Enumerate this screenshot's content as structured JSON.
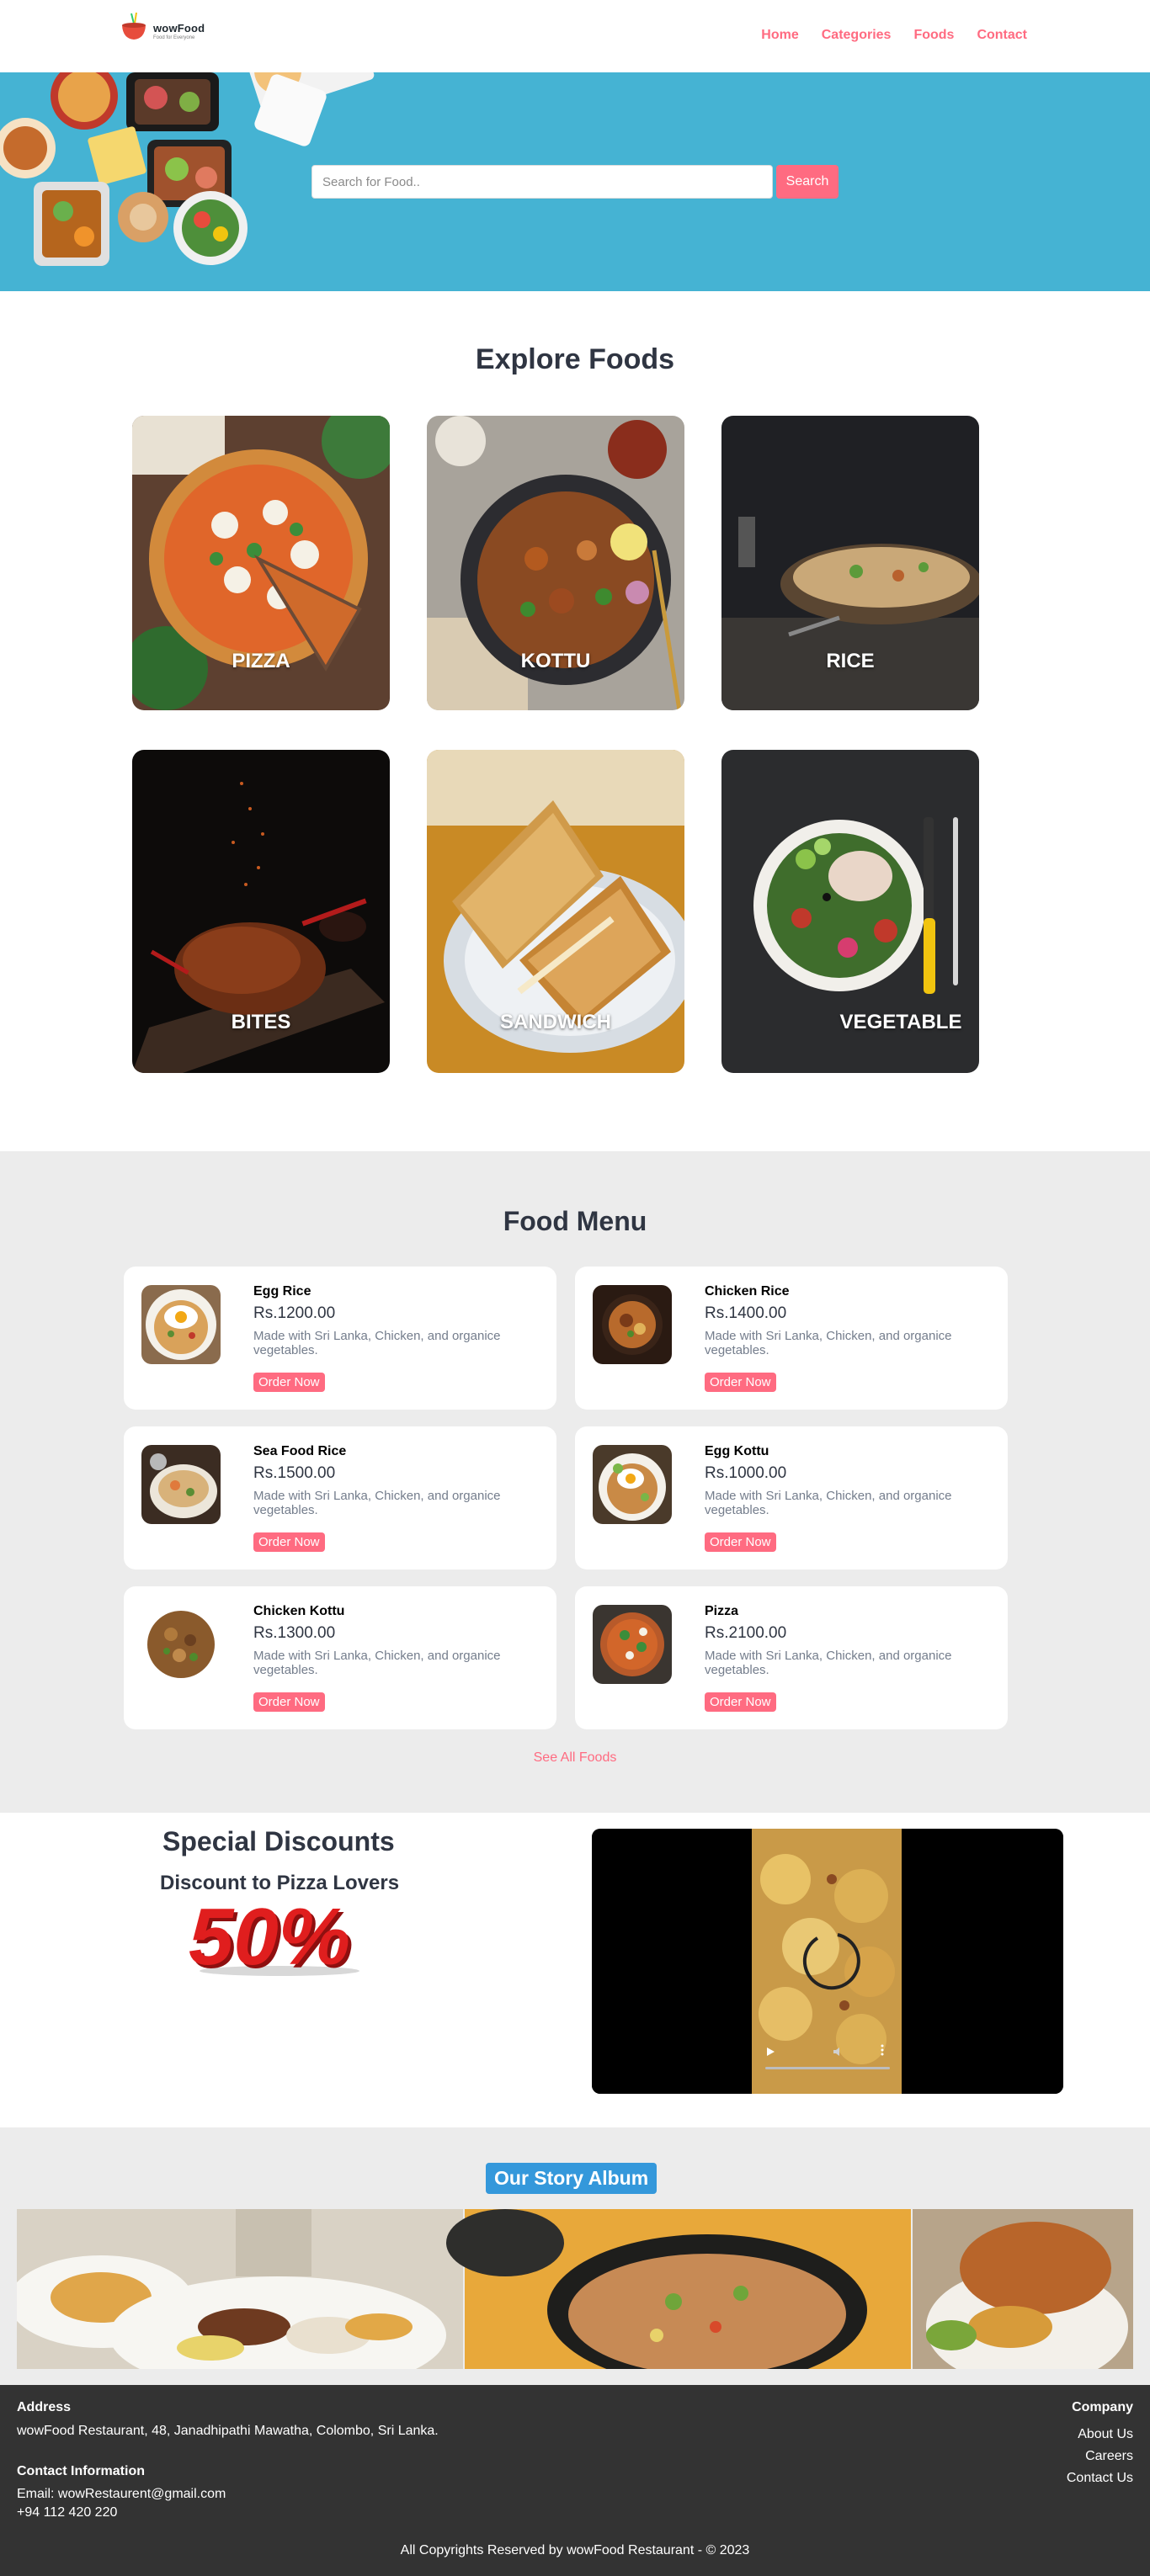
{
  "nav": {
    "logo_name": "wowFood",
    "logo_tagline": "Food for Everyone",
    "links": [
      "Home",
      "Categories",
      "Foods",
      "Contact"
    ]
  },
  "hero": {
    "search_placeholder": "Search for Food..",
    "search_button": "Search"
  },
  "explore": {
    "title": "Explore Foods",
    "categories": [
      "PIZZA",
      "KOTTU",
      "RICE",
      "BITES",
      "SANDWICH",
      "VEGETABLE"
    ]
  },
  "food_menu": {
    "title": "Food Menu",
    "items": [
      {
        "name": "Egg Rice",
        "price": "Rs.1200.00",
        "desc": "Made with Sri Lanka, Chicken, and organice vegetables.",
        "button": "Order Now"
      },
      {
        "name": "Chicken Rice",
        "price": "Rs.1400.00",
        "desc": "Made with Sri Lanka, Chicken, and organice vegetables.",
        "button": "Order Now"
      },
      {
        "name": "Sea Food Rice",
        "price": "Rs.1500.00",
        "desc": "Made with Sri Lanka, Chicken, and organice vegetables.",
        "button": "Order Now"
      },
      {
        "name": "Egg Kottu",
        "price": "Rs.1000.00",
        "desc": "Made with Sri Lanka, Chicken, and organice vegetables.",
        "button": "Order Now"
      },
      {
        "name": "Chicken Kottu",
        "price": "Rs.1300.00",
        "desc": "Made with Sri Lanka, Chicken, and organice vegetables.",
        "button": "Order Now"
      },
      {
        "name": "Pizza",
        "price": "Rs.2100.00",
        "desc": "Made with Sri Lanka, Chicken, and organice vegetables.",
        "button": "Order Now"
      }
    ],
    "see_all": "See All Foods"
  },
  "discount": {
    "title": "Special Discounts",
    "subtitle": "Discount to Pizza Lovers",
    "badge": "50%"
  },
  "story": {
    "title": "Our Story Album"
  },
  "footer": {
    "address_heading": "Address",
    "address": "wowFood Restaurant, 48, Janadhipathi Mawatha, Colombo, Sri Lanka.",
    "contact_heading": "Contact Information",
    "email": "Email: wowRestaurent@gmail.com",
    "phone": "+94 112 420 220",
    "company_heading": "Company",
    "company_links": [
      "About Us",
      "Careers",
      "Contact Us"
    ],
    "copyright": "All Copyrights Reserved by wowFood Restaurant - © 2023"
  },
  "colors": {
    "accent": "#ff6b81",
    "hero_bg": "#45b3d3",
    "section_bg": "#ececec",
    "footer_bg": "#333333",
    "story_badge": "#3498db"
  }
}
